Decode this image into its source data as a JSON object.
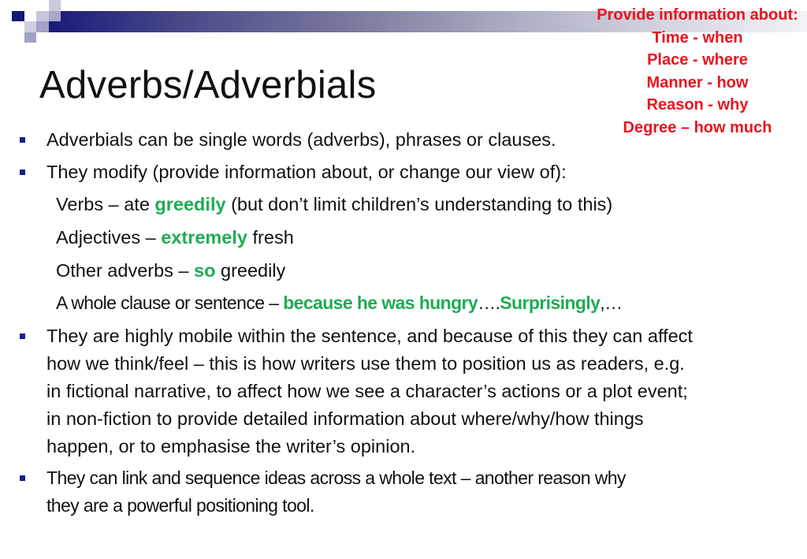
{
  "colors": {
    "accent_navy": "#1a1a8c",
    "highlight_green": "#1fab54",
    "info_red": "#e8141e",
    "text": "#111111"
  },
  "title": "Adverbs/Adverbials",
  "info_box": {
    "heading": "Provide information about:",
    "items": [
      "Time - when",
      "Place - where",
      "Manner - how",
      "Reason - why",
      "Degree – how much"
    ]
  },
  "bullets": [
    {
      "icon": "square-bullet-icon",
      "text": "Adverbials can be single words (adverbs), phrases or clauses."
    },
    {
      "icon": "square-bullet-icon",
      "text": "They modify (provide information about, or change our view of):",
      "sub_lines": [
        {
          "pre": "Verbs – ate ",
          "highlight": "greedily",
          "post": " (but don’t limit children’s understanding to this)"
        },
        {
          "pre": "Adjectives – ",
          "highlight": "extremely",
          "post": " fresh"
        },
        {
          "pre": "Other adverbs – ",
          "highlight": "so",
          "post": " greedily"
        },
        {
          "pre": "A whole clause or sentence – ",
          "highlight": "because he was hungry",
          "mid": "….",
          "highlight2": "Surprisingly",
          "post": ",…"
        }
      ]
    },
    {
      "icon": "square-bullet-icon",
      "lines": [
        "They are highly mobile within the sentence, and because of this they can affect",
        "how we think/feel – this is how writers use them to position us as readers, e.g.",
        "in fictional narrative, to affect how we see a character’s actions or a plot event;",
        "in non-fiction to provide detailed information about where/why/how things",
        "happen, or to emphasise the writer’s opinion."
      ]
    },
    {
      "icon": "square-bullet-icon",
      "lines": [
        "They can link and sequence ideas across a whole text – another reason why",
        "they are a powerful positioning tool."
      ]
    }
  ]
}
